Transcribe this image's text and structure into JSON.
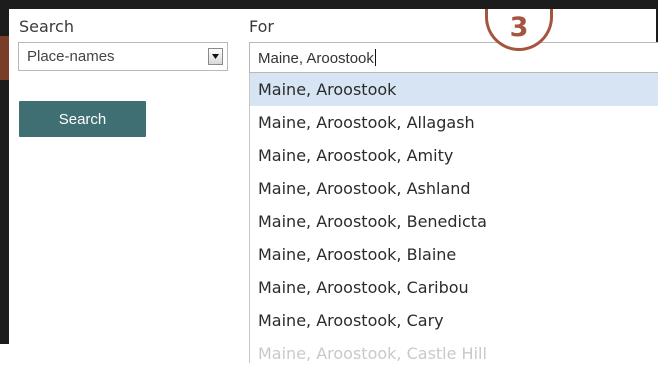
{
  "search": {
    "label": "Search",
    "select_value": "Place-names",
    "button_label": "Search"
  },
  "for": {
    "label": "For",
    "input_value": "Maine, Aroostook"
  },
  "suggestions": [
    "Maine, Aroostook",
    "Maine, Aroostook, Allagash",
    "Maine, Aroostook, Amity",
    "Maine, Aroostook, Ashland",
    "Maine, Aroostook, Benedicta",
    "Maine, Aroostook, Blaine",
    "Maine, Aroostook, Caribou",
    "Maine, Aroostook, Cary",
    "Maine, Aroostook, Castle Hill"
  ],
  "step_badge": "3",
  "colors": {
    "button_bg": "#3f6e73",
    "highlight_bg": "#d6e4f3",
    "badge_color": "#a4553f"
  }
}
